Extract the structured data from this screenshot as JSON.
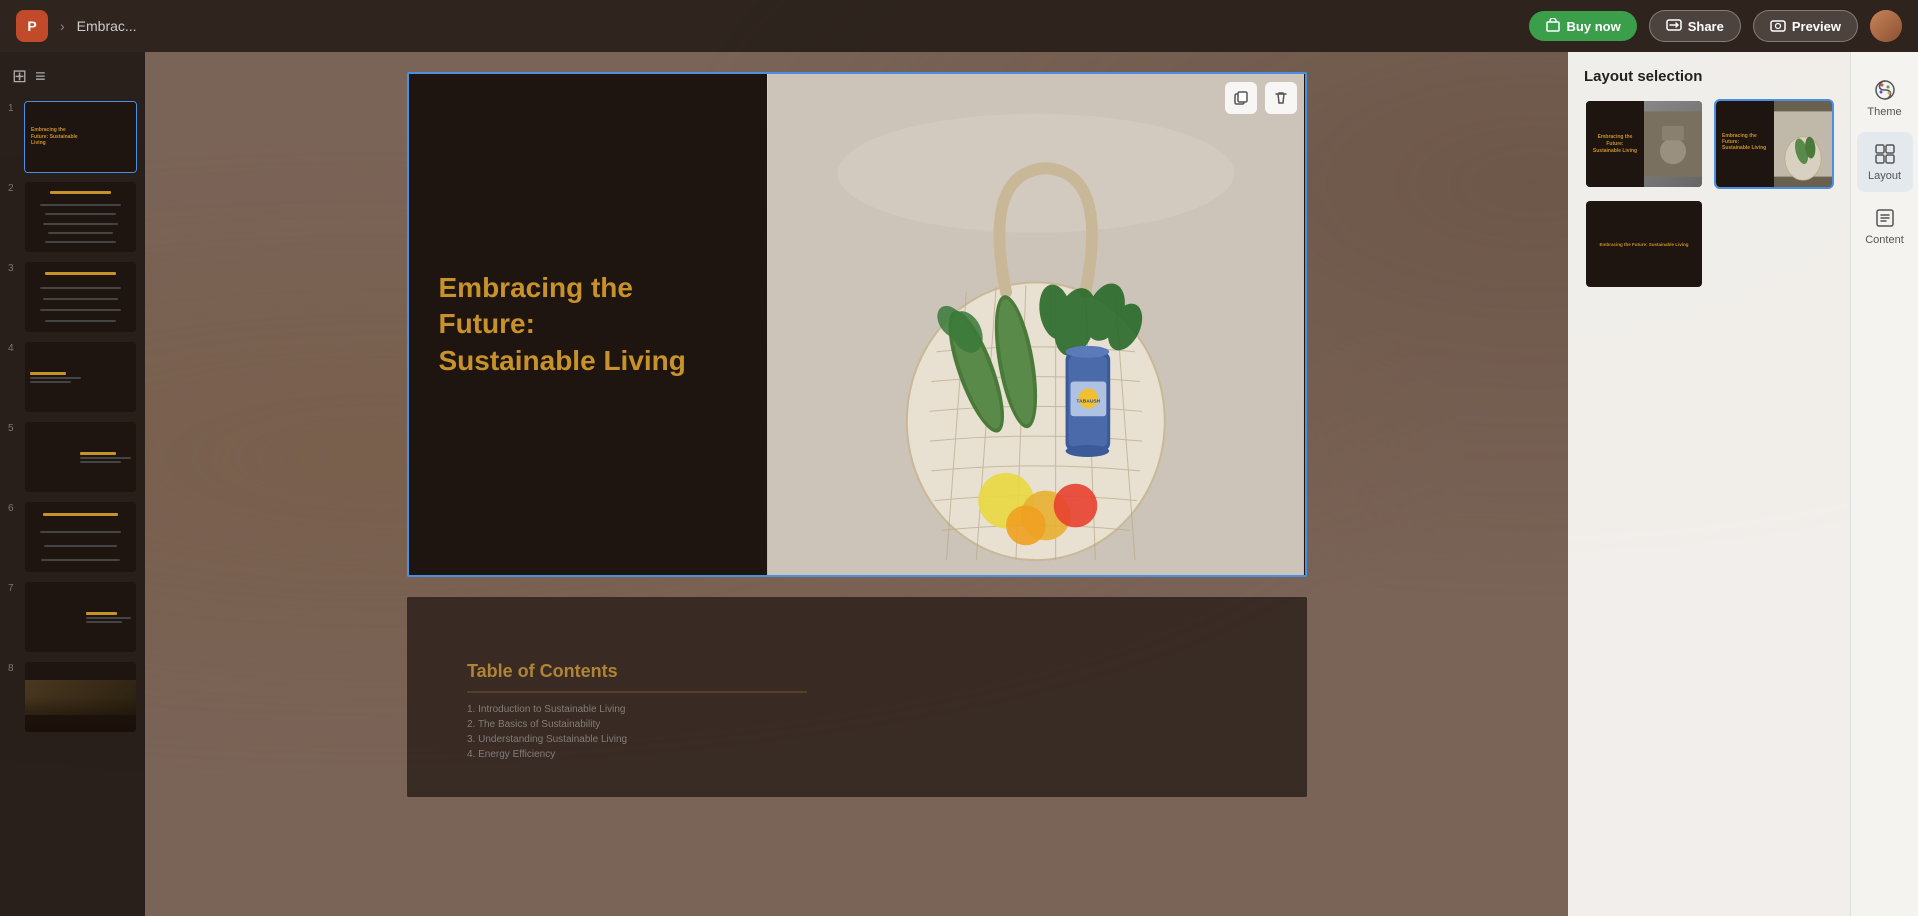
{
  "topbar": {
    "logo_text": "P",
    "chevron": "›",
    "title": "Embrac...",
    "buy_label": "Buy now",
    "share_label": "Share",
    "preview_label": "Preview"
  },
  "left_panel": {
    "view_toggle": [
      "grid-icon",
      "list-icon"
    ],
    "slides": [
      {
        "num": "1",
        "type": "title-image",
        "active": true
      },
      {
        "num": "2",
        "type": "table-of-contents"
      },
      {
        "num": "3",
        "type": "text-content"
      },
      {
        "num": "4",
        "type": "text-image"
      },
      {
        "num": "5",
        "type": "image-text"
      },
      {
        "num": "6",
        "type": "text-only"
      },
      {
        "num": "7",
        "type": "image-split"
      },
      {
        "num": "8",
        "type": "dark-image"
      }
    ]
  },
  "slide": {
    "title_line1": "Embracing the Future:",
    "title_line2": "Sustainable Living",
    "title_color": "#c8922a",
    "bg_color": "#1e1410"
  },
  "slide_controls": {
    "copy_icon": "⧉",
    "delete_icon": "🗑"
  },
  "layout_selection": {
    "panel_title": "Layout selection",
    "options": [
      {
        "id": "opt1",
        "label": "title-left",
        "selected": false
      },
      {
        "id": "opt2",
        "label": "title-right-image",
        "selected": true
      },
      {
        "id": "opt3",
        "label": "centered-title",
        "selected": false
      }
    ]
  },
  "right_sidebar": {
    "items": [
      {
        "id": "theme",
        "label": "Theme",
        "icon": "palette-icon"
      },
      {
        "id": "layout",
        "label": "Layout",
        "icon": "layout-icon"
      },
      {
        "id": "content",
        "label": "Content",
        "icon": "content-icon"
      }
    ]
  }
}
